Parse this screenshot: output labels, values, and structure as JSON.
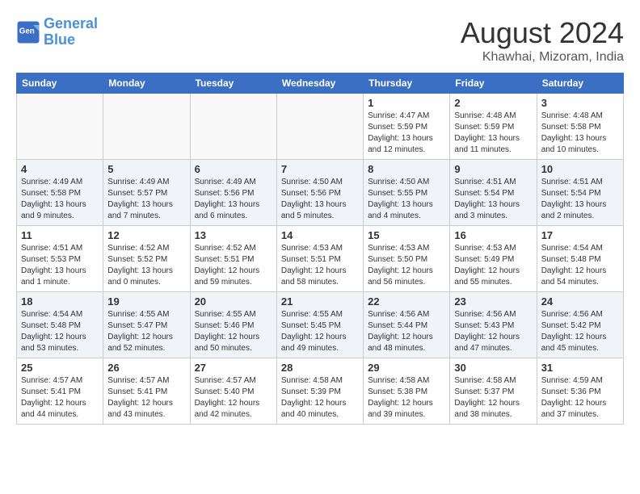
{
  "header": {
    "logo_line1": "General",
    "logo_line2": "Blue",
    "month_year": "August 2024",
    "location": "Khawhai, Mizoram, India"
  },
  "weekdays": [
    "Sunday",
    "Monday",
    "Tuesday",
    "Wednesday",
    "Thursday",
    "Friday",
    "Saturday"
  ],
  "weeks": [
    [
      {
        "day": "",
        "info": ""
      },
      {
        "day": "",
        "info": ""
      },
      {
        "day": "",
        "info": ""
      },
      {
        "day": "",
        "info": ""
      },
      {
        "day": "1",
        "info": "Sunrise: 4:47 AM\nSunset: 5:59 PM\nDaylight: 13 hours\nand 12 minutes."
      },
      {
        "day": "2",
        "info": "Sunrise: 4:48 AM\nSunset: 5:59 PM\nDaylight: 13 hours\nand 11 minutes."
      },
      {
        "day": "3",
        "info": "Sunrise: 4:48 AM\nSunset: 5:58 PM\nDaylight: 13 hours\nand 10 minutes."
      }
    ],
    [
      {
        "day": "4",
        "info": "Sunrise: 4:49 AM\nSunset: 5:58 PM\nDaylight: 13 hours\nand 9 minutes."
      },
      {
        "day": "5",
        "info": "Sunrise: 4:49 AM\nSunset: 5:57 PM\nDaylight: 13 hours\nand 7 minutes."
      },
      {
        "day": "6",
        "info": "Sunrise: 4:49 AM\nSunset: 5:56 PM\nDaylight: 13 hours\nand 6 minutes."
      },
      {
        "day": "7",
        "info": "Sunrise: 4:50 AM\nSunset: 5:56 PM\nDaylight: 13 hours\nand 5 minutes."
      },
      {
        "day": "8",
        "info": "Sunrise: 4:50 AM\nSunset: 5:55 PM\nDaylight: 13 hours\nand 4 minutes."
      },
      {
        "day": "9",
        "info": "Sunrise: 4:51 AM\nSunset: 5:54 PM\nDaylight: 13 hours\nand 3 minutes."
      },
      {
        "day": "10",
        "info": "Sunrise: 4:51 AM\nSunset: 5:54 PM\nDaylight: 13 hours\nand 2 minutes."
      }
    ],
    [
      {
        "day": "11",
        "info": "Sunrise: 4:51 AM\nSunset: 5:53 PM\nDaylight: 13 hours\nand 1 minute."
      },
      {
        "day": "12",
        "info": "Sunrise: 4:52 AM\nSunset: 5:52 PM\nDaylight: 13 hours\nand 0 minutes."
      },
      {
        "day": "13",
        "info": "Sunrise: 4:52 AM\nSunset: 5:51 PM\nDaylight: 12 hours\nand 59 minutes."
      },
      {
        "day": "14",
        "info": "Sunrise: 4:53 AM\nSunset: 5:51 PM\nDaylight: 12 hours\nand 58 minutes."
      },
      {
        "day": "15",
        "info": "Sunrise: 4:53 AM\nSunset: 5:50 PM\nDaylight: 12 hours\nand 56 minutes."
      },
      {
        "day": "16",
        "info": "Sunrise: 4:53 AM\nSunset: 5:49 PM\nDaylight: 12 hours\nand 55 minutes."
      },
      {
        "day": "17",
        "info": "Sunrise: 4:54 AM\nSunset: 5:48 PM\nDaylight: 12 hours\nand 54 minutes."
      }
    ],
    [
      {
        "day": "18",
        "info": "Sunrise: 4:54 AM\nSunset: 5:48 PM\nDaylight: 12 hours\nand 53 minutes."
      },
      {
        "day": "19",
        "info": "Sunrise: 4:55 AM\nSunset: 5:47 PM\nDaylight: 12 hours\nand 52 minutes."
      },
      {
        "day": "20",
        "info": "Sunrise: 4:55 AM\nSunset: 5:46 PM\nDaylight: 12 hours\nand 50 minutes."
      },
      {
        "day": "21",
        "info": "Sunrise: 4:55 AM\nSunset: 5:45 PM\nDaylight: 12 hours\nand 49 minutes."
      },
      {
        "day": "22",
        "info": "Sunrise: 4:56 AM\nSunset: 5:44 PM\nDaylight: 12 hours\nand 48 minutes."
      },
      {
        "day": "23",
        "info": "Sunrise: 4:56 AM\nSunset: 5:43 PM\nDaylight: 12 hours\nand 47 minutes."
      },
      {
        "day": "24",
        "info": "Sunrise: 4:56 AM\nSunset: 5:42 PM\nDaylight: 12 hours\nand 45 minutes."
      }
    ],
    [
      {
        "day": "25",
        "info": "Sunrise: 4:57 AM\nSunset: 5:41 PM\nDaylight: 12 hours\nand 44 minutes."
      },
      {
        "day": "26",
        "info": "Sunrise: 4:57 AM\nSunset: 5:41 PM\nDaylight: 12 hours\nand 43 minutes."
      },
      {
        "day": "27",
        "info": "Sunrise: 4:57 AM\nSunset: 5:40 PM\nDaylight: 12 hours\nand 42 minutes."
      },
      {
        "day": "28",
        "info": "Sunrise: 4:58 AM\nSunset: 5:39 PM\nDaylight: 12 hours\nand 40 minutes."
      },
      {
        "day": "29",
        "info": "Sunrise: 4:58 AM\nSunset: 5:38 PM\nDaylight: 12 hours\nand 39 minutes."
      },
      {
        "day": "30",
        "info": "Sunrise: 4:58 AM\nSunset: 5:37 PM\nDaylight: 12 hours\nand 38 minutes."
      },
      {
        "day": "31",
        "info": "Sunrise: 4:59 AM\nSunset: 5:36 PM\nDaylight: 12 hours\nand 37 minutes."
      }
    ]
  ]
}
